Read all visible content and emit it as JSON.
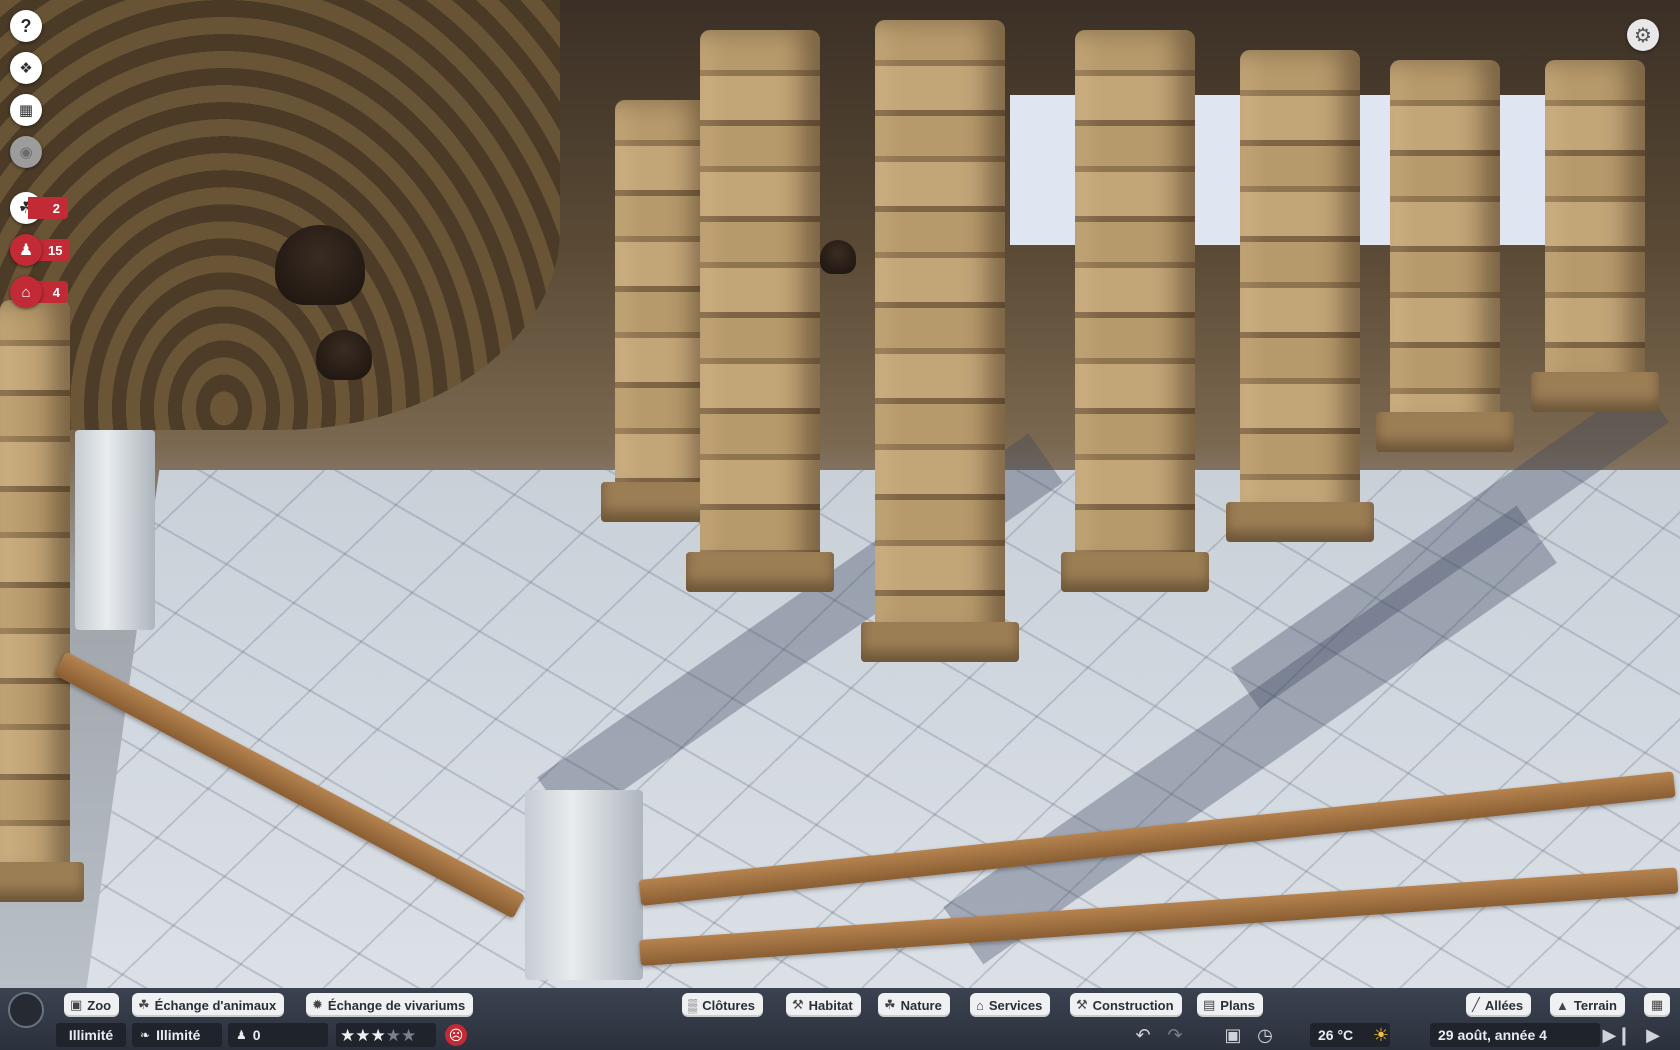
{
  "left_hud": {
    "help_icon": "question-icon",
    "items": [
      {
        "name": "animals-alert",
        "icon": "paw-icon",
        "count": "2"
      },
      {
        "name": "staff-alert",
        "icon": "person-icon",
        "count": "15"
      },
      {
        "name": "facilities-alert",
        "icon": "shop-icon",
        "count": "4"
      }
    ]
  },
  "toolbar": {
    "zoo": "Zoo",
    "animal_exchange": "Échange d'animaux",
    "vivarium_exchange": "Échange de vivariums",
    "fences": "Clôtures",
    "habitat": "Habitat",
    "nature": "Nature",
    "services": "Services",
    "construction": "Construction",
    "plans": "Plans",
    "paths": "Allées",
    "terrain": "Terrain"
  },
  "status": {
    "money": "Illimité",
    "research": "Illimité",
    "guests": "0",
    "rating_stars": 3,
    "rating_max": 5,
    "temperature": "26 °C",
    "date": "29 août, année 4"
  },
  "colors": {
    "alert_red": "#c22a35",
    "bar_bg": "#2f3540",
    "pill_bg": "#eef0f2"
  }
}
